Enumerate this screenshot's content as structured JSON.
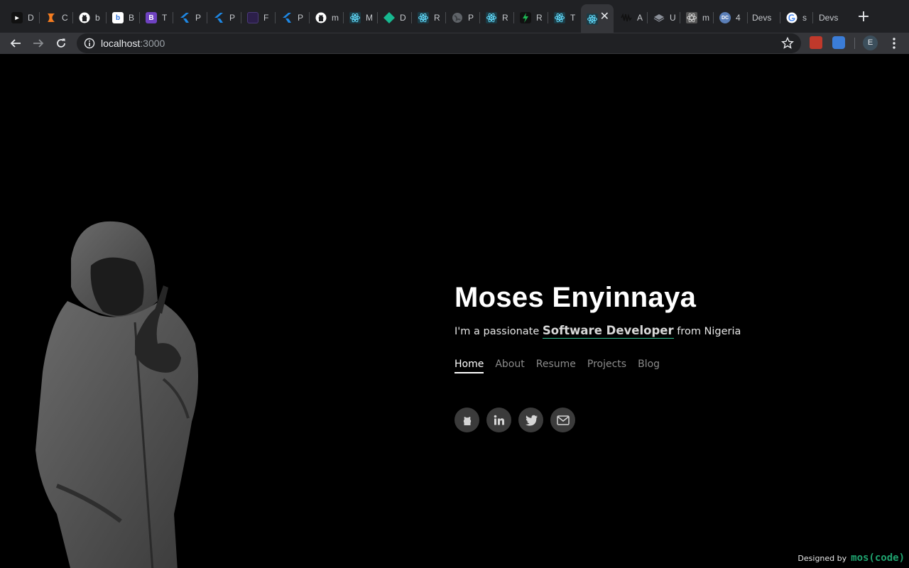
{
  "browser": {
    "tabs": [
      {
        "label": "D",
        "icon": "app-icon",
        "color": "#111111"
      },
      {
        "label": "C",
        "icon": "codepen-orange-icon",
        "color": "#f47c20"
      },
      {
        "label": "b",
        "icon": "github-icon",
        "color": "#ffffff"
      },
      {
        "label": "B",
        "icon": "bulb-icon",
        "color": "#2a6fdb"
      },
      {
        "label": "T",
        "icon": "bootstrap-icon",
        "color": "#6f42c1"
      },
      {
        "label": "P",
        "icon": "flutter-icon",
        "color": "#1e88e5"
      },
      {
        "label": "P",
        "icon": "flutter-icon",
        "color": "#1e88e5"
      },
      {
        "label": "F",
        "icon": "figma-icon",
        "color": "#2c1f4a"
      },
      {
        "label": "P",
        "icon": "flutter-icon",
        "color": "#1e88e5"
      },
      {
        "label": "m",
        "icon": "github-icon",
        "color": "#ffffff"
      },
      {
        "label": "M",
        "icon": "react-icon",
        "color": "#61dafb"
      },
      {
        "label": "D",
        "icon": "diamond-icon",
        "color": "#17b890"
      },
      {
        "label": "R",
        "icon": "react-icon",
        "color": "#61dafb"
      },
      {
        "label": "P",
        "icon": "globe-icon",
        "color": "#777777"
      },
      {
        "label": "R",
        "icon": "react-icon",
        "color": "#61dafb"
      },
      {
        "label": "R",
        "icon": "bolt-icon",
        "color": "#1db954"
      },
      {
        "label": "T",
        "icon": "react-icon",
        "color": "#61dafb"
      },
      {
        "label": "",
        "icon": "react-icon",
        "color": "#61dafb",
        "active": true
      },
      {
        "label": "A",
        "icon": "wave-icon",
        "color": "#222222"
      },
      {
        "label": "U",
        "icon": "layers-icon",
        "color": "#8a8f98"
      },
      {
        "label": "m",
        "icon": "react-gray-icon",
        "color": "#aaaaaa"
      },
      {
        "label": "4",
        "icon": "dc-icon",
        "color": "#5b7fb8"
      },
      {
        "label": "Devs",
        "icon": "",
        "color": ""
      },
      {
        "label": "s",
        "icon": "google-icon",
        "color": "#ea4335"
      },
      {
        "label": "Devs",
        "icon": "",
        "color": ""
      }
    ],
    "url_host": "localhost",
    "url_port": ":3000",
    "profile_initial": "E"
  },
  "hero": {
    "name": "Moses Enyinnaya",
    "tagline_prefix": "I'm a passionate ",
    "tagline_role": "Software Developer",
    "tagline_suffix": " from Nigeria"
  },
  "menu": [
    {
      "label": "Home",
      "active": true
    },
    {
      "label": "About"
    },
    {
      "label": "Resume"
    },
    {
      "label": "Projects"
    },
    {
      "label": "Blog"
    }
  ],
  "social": [
    "github-icon",
    "linkedin-icon",
    "twitter-icon",
    "mail-icon"
  ],
  "footer": {
    "credit_prefix": "Designed by",
    "brand": "mos(code)"
  },
  "colors": {
    "accent": "#2fbf8f",
    "brand": "#1fa36f"
  }
}
